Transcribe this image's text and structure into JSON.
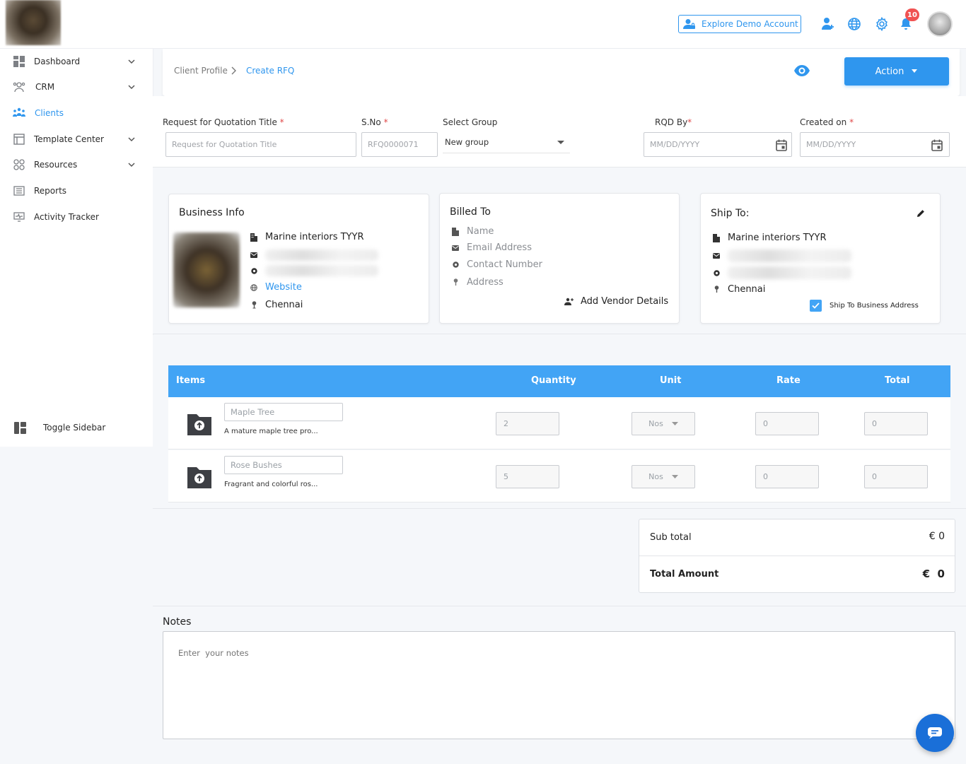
{
  "topbar": {
    "demo_button": "Explore Demo Account",
    "notification_count": "10"
  },
  "sidebar": {
    "items": [
      {
        "label": "Dashboard",
        "icon": "dashboard-icon",
        "has_chevron": true
      },
      {
        "label": "CRM",
        "icon": "crm-icon",
        "has_chevron": true
      },
      {
        "label": "Clients",
        "icon": "clients-icon",
        "has_chevron": false,
        "active": true
      },
      {
        "label": "Template Center",
        "icon": "template-icon",
        "has_chevron": true
      },
      {
        "label": "Resources",
        "icon": "resources-icon",
        "has_chevron": true
      },
      {
        "label": "Reports",
        "icon": "reports-icon",
        "has_chevron": false
      },
      {
        "label": "Activity Tracker",
        "icon": "activity-icon",
        "has_chevron": false
      }
    ],
    "toggle_label": "Toggle Sidebar"
  },
  "header": {
    "breadcrumb_parent": "Client Profile",
    "breadcrumb_current": "Create RFQ",
    "action_label": "Action"
  },
  "form": {
    "title_label": "Request for Quotation Title",
    "title_placeholder": "Request for Quotation Title",
    "sno_label": "S.No",
    "sno_value": "RFQ0000071",
    "group_label": "Select Group",
    "group_value": "New group",
    "rqd_label": "RQD By",
    "rqd_placeholder": "MM/DD/YYYY",
    "created_label": "Created on",
    "created_placeholder": "MM/DD/YYYY"
  },
  "business_info": {
    "title": "Business Info",
    "company": "Marine interiors TYYR",
    "website": "Website",
    "city": "Chennai"
  },
  "billed_to": {
    "title": "Billed To",
    "name": "Name",
    "email": "Email Address",
    "contact": "Contact Number",
    "address": "Address",
    "add_vendor": "Add Vendor Details"
  },
  "ship_to": {
    "title": "Ship To:",
    "company": "Marine interiors TYYR",
    "city": "Chennai",
    "checkbox_label": "Ship To Business Address",
    "checked": true
  },
  "items_table": {
    "headers": {
      "items": "Items",
      "quantity": "Quantity",
      "unit": "Unit",
      "rate": "Rate",
      "total": "Total"
    },
    "rows": [
      {
        "name": "Maple Tree",
        "description": "A mature maple tree pro...",
        "quantity": "2",
        "unit": "Nos",
        "rate": "0",
        "total": "0"
      },
      {
        "name": "Rose Bushes",
        "description": "Fragrant and colorful ros...",
        "quantity": "5",
        "unit": "Nos",
        "rate": "0",
        "total": "0"
      }
    ]
  },
  "totals": {
    "subtotal_label": "Sub total",
    "subtotal_value": "€ 0",
    "total_label": "Total Amount",
    "total_value": "€  0"
  },
  "notes": {
    "label": "Notes",
    "placeholder": "Enter  your notes"
  },
  "colors": {
    "accent": "#2f96ee",
    "table_header": "#42a4f5",
    "badge": "#f05252"
  }
}
